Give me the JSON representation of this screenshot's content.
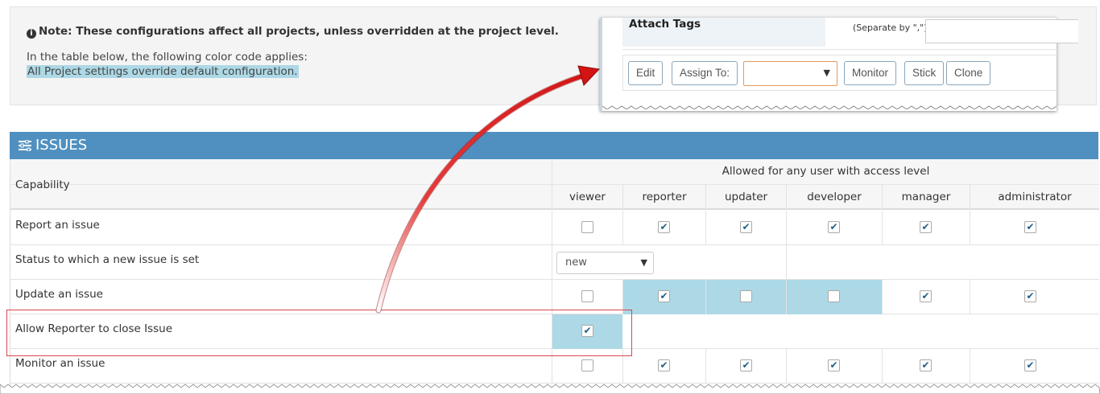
{
  "info": {
    "note": "Note: These configurations affect all projects, unless overridden at the project level.",
    "line1": "In the table below, the following color code applies:",
    "line2": "All Project settings override default configuration."
  },
  "inset": {
    "attach_tags_label": "Attach Tags",
    "separate_hint": "(Separate by \",\")",
    "buttons": {
      "edit": "Edit",
      "assign_to": "Assign To:",
      "monitor": "Monitor",
      "stick": "Stick",
      "clone": "Clone"
    },
    "assign_select_value": ""
  },
  "issues": {
    "title": "ISSUES",
    "capability_header": "Capability",
    "allowed_header": "Allowed for any user with access level",
    "levels": [
      "viewer",
      "reporter",
      "updater",
      "developer",
      "manager",
      "administrator"
    ],
    "rows": [
      {
        "label": "Report an issue",
        "checks": [
          false,
          true,
          true,
          true,
          true,
          true
        ]
      },
      {
        "label": "Status to which a new issue is set",
        "select_value": "new"
      },
      {
        "label": "Update an issue",
        "checks": [
          false,
          true,
          false,
          false,
          true,
          true
        ]
      },
      {
        "label": "Allow Reporter to close Issue",
        "checks": [
          true
        ]
      },
      {
        "label": "Monitor an issue",
        "checks": [
          false,
          true,
          true,
          true,
          true,
          true
        ]
      }
    ]
  },
  "colors": {
    "header_blue": "#4f90c0",
    "highlight_cell": "#add8e6",
    "annotation_red": "#d9474f"
  }
}
